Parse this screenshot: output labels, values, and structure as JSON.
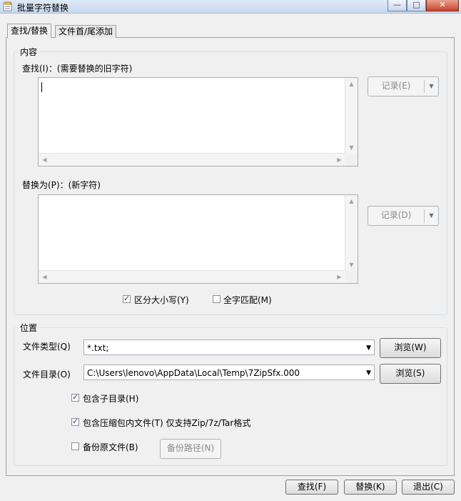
{
  "window": {
    "title": "批量字符替换",
    "min": "—",
    "max": "□",
    "close": "✕"
  },
  "tabs": [
    "查找/替换",
    "文件首/尾添加"
  ],
  "content": {
    "legend": "内容",
    "find_label": "查找(I)：(需要替换的旧字符)",
    "find_value": "",
    "find_history_button": "记录(E)",
    "replace_label": "替换为(P)：(新字符)",
    "replace_value": "",
    "replace_history_button": "记录(D)",
    "case_sensitive": {
      "label": "区分大小写(Y)",
      "checked": true
    },
    "whole_word": {
      "label": "全字匹配(M)",
      "checked": false
    }
  },
  "location": {
    "legend": "位置",
    "file_type_label": "文件类型(Q)",
    "file_type_value": "*.txt;",
    "browse_type_button": "浏览(W)",
    "file_dir_label": "文件目录(O)",
    "file_dir_value": "C:\\Users\\lenovo\\AppData\\Local\\Temp\\7ZipSfx.000",
    "browse_dir_button": "浏览(S)",
    "include_subdirs": {
      "label": "包含子目录(H)",
      "checked": true
    },
    "include_archives": {
      "label": "包含压缩包内文件(T) 仅支持Zip/7z/Tar格式",
      "checked": true
    },
    "backup": {
      "label": "备份原文件(B)",
      "checked": false
    },
    "backup_path_button": "备份路径(N)"
  },
  "footer": {
    "find_button": "查找(F)",
    "replace_button": "替换(K)",
    "exit_button": "退出(C)"
  }
}
